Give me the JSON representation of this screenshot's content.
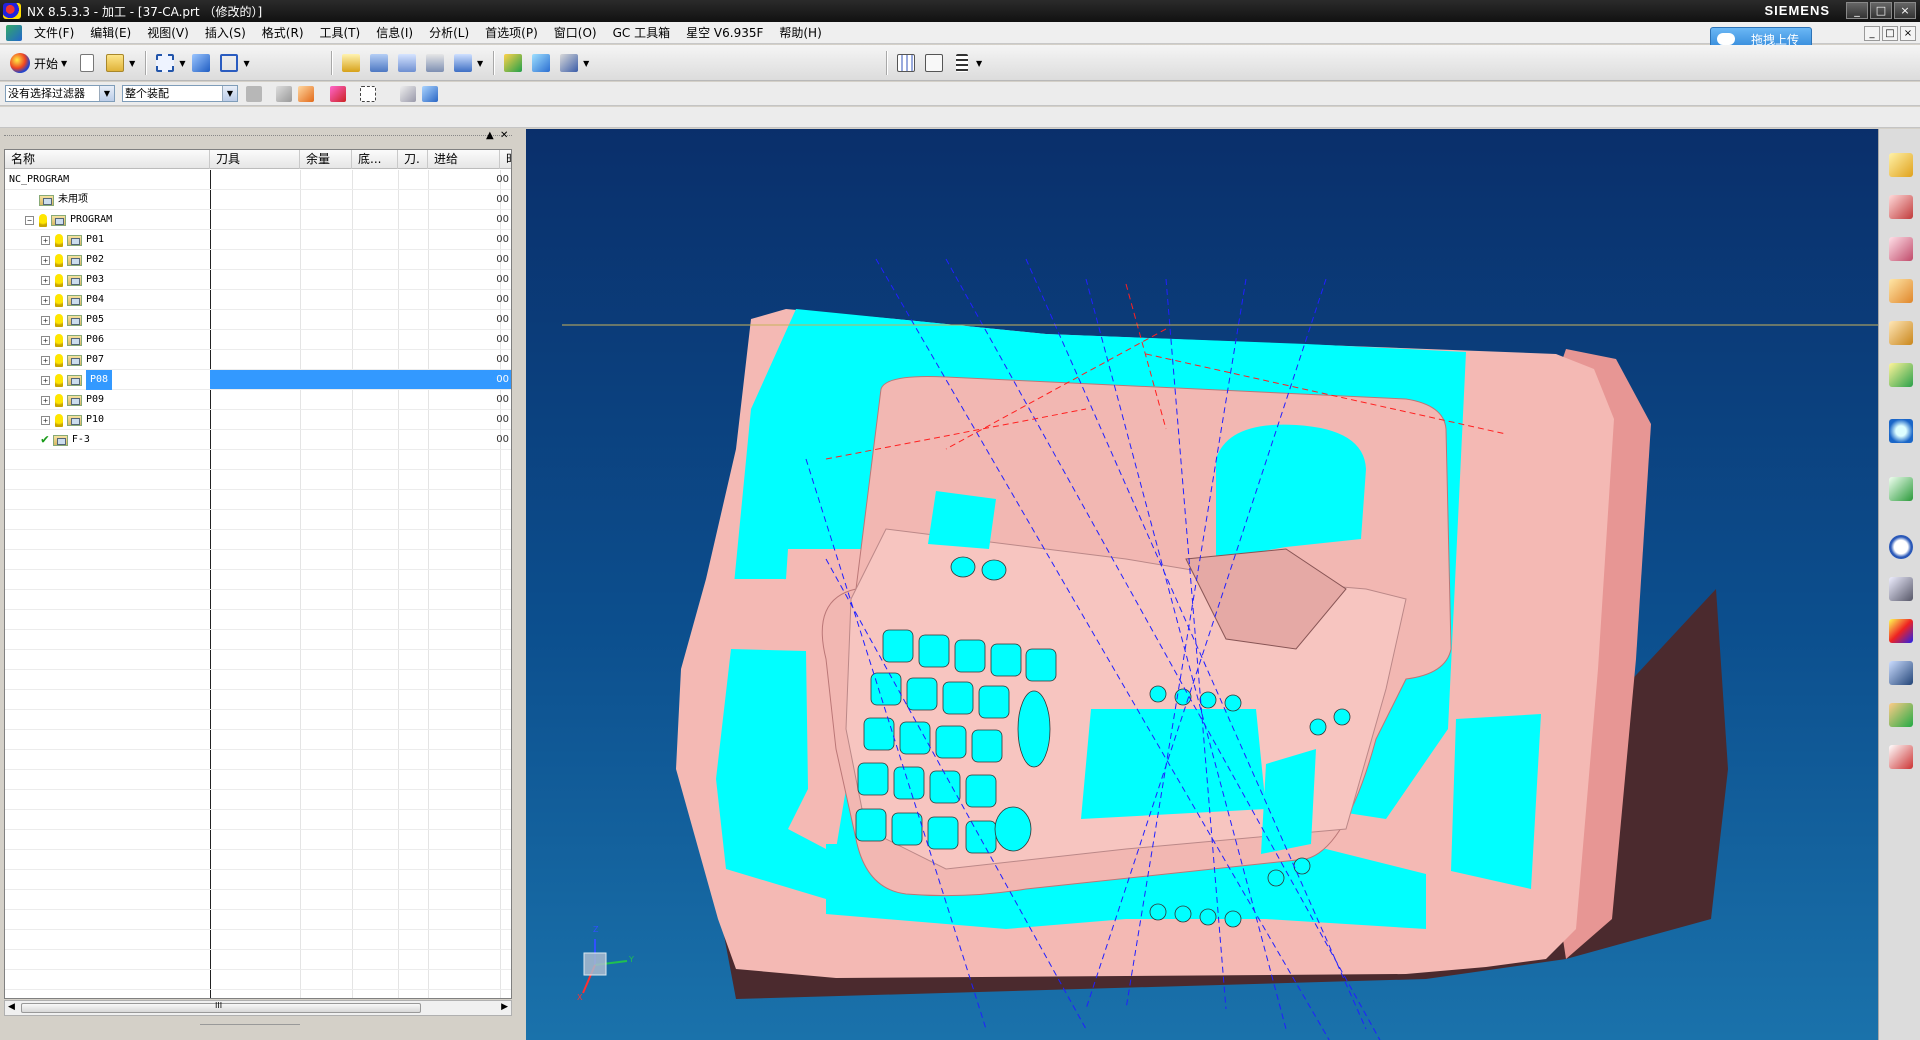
{
  "window": {
    "title": "NX 8.5.3.3 - 加工 - [37-CA.prt （修改的）]",
    "brand": "SIEMENS",
    "upload_label": "拖拽上传",
    "controls": [
      "_",
      "□",
      "×"
    ]
  },
  "menu": {
    "items": [
      "文件(F)",
      "编辑(E)",
      "视图(V)",
      "插入(S)",
      "格式(R)",
      "工具(T)",
      "信息(I)",
      "分析(L)",
      "首选项(P)",
      "窗口(O)",
      "GC 工具箱",
      "星空 V6.935F",
      "帮助(H)"
    ]
  },
  "toolbar": {
    "start_label": "开始",
    "filter_combo": "没有选择过滤器",
    "assembly_combo": "整个装配",
    "icons": [
      "new-file-icon",
      "open-folder-icon",
      "fit-view-icon",
      "shaded-view-icon",
      "wireframe-view-icon",
      "create-program-icon",
      "create-tool-icon",
      "create-geometry-icon",
      "create-method-icon",
      "create-operation-icon",
      "generate-toolpath-icon",
      "verify-toolpath-icon",
      "postprocess-icon",
      "transparent-icon",
      "machining-icon",
      "list-icon"
    ],
    "colors": {
      "accent": "#3399ff",
      "upload": "#2f86d8"
    }
  },
  "navigator": {
    "columns": [
      "名称",
      "刀具",
      "余量",
      "底...",
      "刀.",
      "进给",
      "时"
    ],
    "rows": [
      {
        "name": "NC_PROGRAM",
        "level": 0,
        "expander": "",
        "bulb": false,
        "folder": false,
        "check": false,
        "last": "00",
        "selected": false
      },
      {
        "name": "未用项",
        "level": 1,
        "expander": "",
        "bulb": false,
        "folder": true,
        "check": false,
        "last": "00",
        "selected": false
      },
      {
        "name": "PROGRAM",
        "level": 1,
        "expander": "−",
        "bulb": true,
        "folder": true,
        "check": false,
        "last": "00",
        "selected": false
      },
      {
        "name": "P01",
        "level": 2,
        "expander": "+",
        "bulb": true,
        "folder": true,
        "check": false,
        "last": "00",
        "selected": false
      },
      {
        "name": "P02",
        "level": 2,
        "expander": "+",
        "bulb": true,
        "folder": true,
        "check": false,
        "last": "00",
        "selected": false
      },
      {
        "name": "P03",
        "level": 2,
        "expander": "+",
        "bulb": true,
        "folder": true,
        "check": false,
        "last": "00",
        "selected": false
      },
      {
        "name": "P04",
        "level": 2,
        "expander": "+",
        "bulb": true,
        "folder": true,
        "check": false,
        "last": "00",
        "selected": false
      },
      {
        "name": "P05",
        "level": 2,
        "expander": "+",
        "bulb": true,
        "folder": true,
        "check": false,
        "last": "00",
        "selected": false
      },
      {
        "name": "P06",
        "level": 2,
        "expander": "+",
        "bulb": true,
        "folder": true,
        "check": false,
        "last": "00",
        "selected": false
      },
      {
        "name": "P07",
        "level": 2,
        "expander": "+",
        "bulb": true,
        "folder": true,
        "check": false,
        "last": "00",
        "selected": false
      },
      {
        "name": "P08",
        "level": 2,
        "expander": "+",
        "bulb": true,
        "folder": true,
        "check": false,
        "last": "00",
        "selected": true
      },
      {
        "name": "P09",
        "level": 2,
        "expander": "+",
        "bulb": true,
        "folder": true,
        "check": false,
        "last": "00",
        "selected": false
      },
      {
        "name": "P10",
        "level": 2,
        "expander": "+",
        "bulb": true,
        "folder": true,
        "check": false,
        "last": "00",
        "selected": false
      },
      {
        "name": "F-3",
        "level": 2,
        "expander": "",
        "bulb": false,
        "folder": true,
        "check": true,
        "last": "00",
        "selected": false
      }
    ],
    "scroll_grip": "III"
  },
  "viewport": {
    "colors": {
      "pink": "#f4b9b4",
      "cyan": "#00ffff",
      "dark": "#4b2a2e",
      "toolpath": "#2020ff",
      "toolpath_red": "#ff2020"
    },
    "triad_labels": {
      "x": "X",
      "y": "Y",
      "z": "Z"
    }
  },
  "resource_bar": {
    "icons": [
      "assembly-navigator-icon",
      "constraint-navigator-icon",
      "part-navigator-icon",
      "reuse-library-icon",
      "hd3d-tools-icon",
      "palette-icon",
      "web-browser-icon",
      "history-icon",
      "system-materials-icon",
      "process-studio-icon",
      "knowledge-fusion-icon",
      "roles-icon",
      "system-scenes-icon"
    ]
  }
}
